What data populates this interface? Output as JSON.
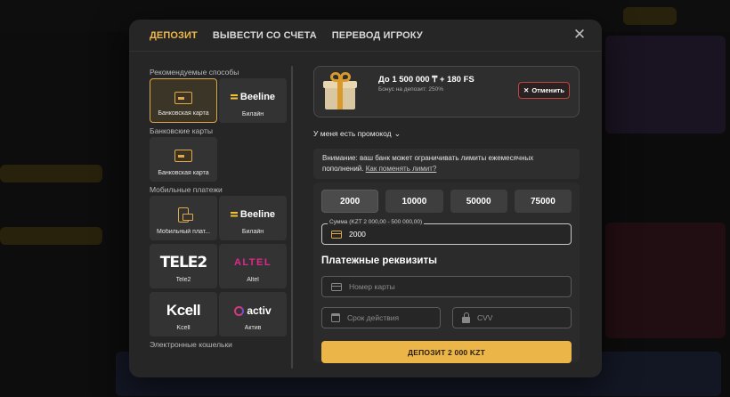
{
  "tabs": [
    "ДЕПОЗИТ",
    "ВЫВЕСТИ СО СЧЕТА",
    "ПЕРЕВОД ИГРОКУ"
  ],
  "close_icon": "close-icon",
  "colors": {
    "accent": "#f0b84a",
    "cancel_border": "#c2443c",
    "deposit_button": "#ebb547"
  },
  "left": {
    "recommended_title": "Рекомендуемые способы",
    "recommended": [
      {
        "label": "Банковская карта",
        "icon": "bank-card-icon",
        "selected": true
      },
      {
        "label": "Билайн",
        "logo": "Beeline"
      }
    ],
    "bank_title": "Банковские карты",
    "bank": [
      {
        "label": "Банковская карта",
        "icon": "bank-card-icon"
      }
    ],
    "mobile_title": "Мобильные платежи",
    "mobile": [
      {
        "label": "Мобильный плат...",
        "icon": "mobile-payment-icon"
      },
      {
        "label": "Билайн",
        "logo": "Beeline"
      },
      {
        "label": "Tele2",
        "logo": "TELE2"
      },
      {
        "label": "Altel",
        "logo": "ALTEL"
      },
      {
        "label": "Kcell",
        "logo": "Kcell"
      },
      {
        "label": "Актив",
        "logo": "activ"
      }
    ],
    "wallets_title": "Электронные кошельки"
  },
  "bonus": {
    "title": "До 1 500 000 ₸ + 180 FS",
    "subtitle": "Бонус на депозит: 250%",
    "cancel_label": "Отменить"
  },
  "promo_label": "У меня есть промокод",
  "warning": {
    "text": "Внимание: ваш банк может ограничивать лимиты ежемесячных пополнений.",
    "link": "Как поменять лимит?"
  },
  "amounts": [
    "2000",
    "10000",
    "50000",
    "75000"
  ],
  "sum_field": {
    "label": "Сумма (KZT 2 000,00 - 500 000,00)",
    "value": "2000"
  },
  "requisites_title": "Платежные реквизиты",
  "card_number_placeholder": "Номер карты",
  "expiry_placeholder": "Срок действия",
  "cvv_placeholder": "CVV",
  "deposit_button": "ДЕПОЗИТ 2 000 KZT"
}
